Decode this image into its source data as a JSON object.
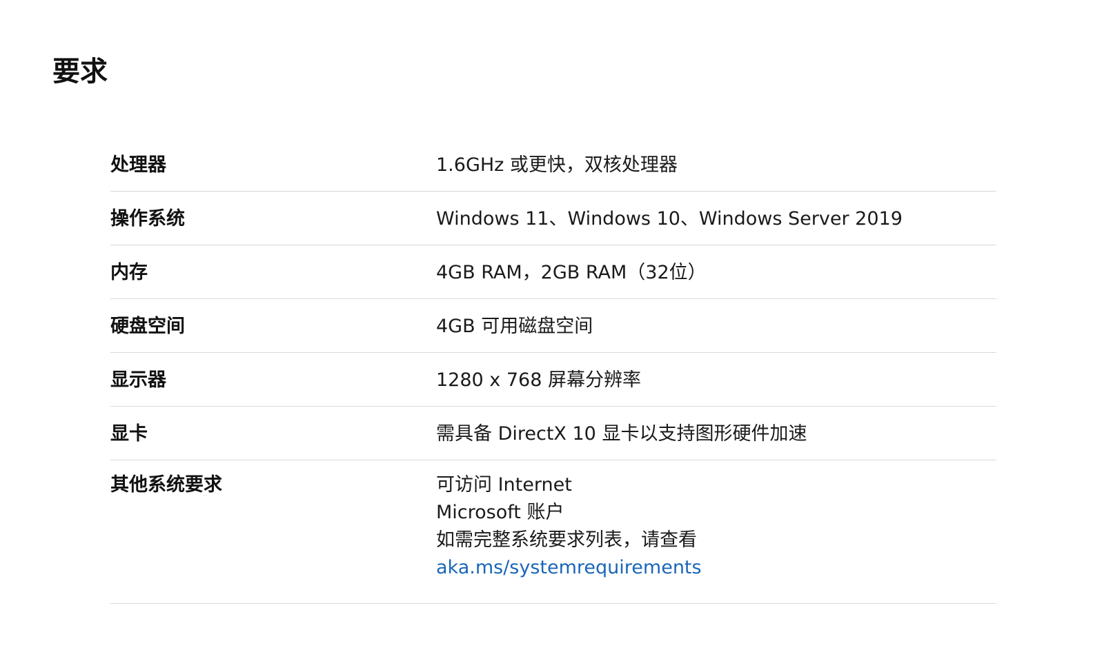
{
  "page": {
    "title": "要求"
  },
  "requirements": [
    {
      "label": "处理器",
      "value": "1.6GHz 或更快，双核处理器"
    },
    {
      "label": "操作系统",
      "value": "Windows 11、Windows 10、Windows Server 2019"
    },
    {
      "label": "内存",
      "value": "4GB RAM，2GB RAM（32位）"
    },
    {
      "label": "硬盘空间",
      "value": "4GB 可用磁盘空间"
    },
    {
      "label": "显示器",
      "value": "1280 x 768 屏幕分辨率"
    },
    {
      "label": "显卡",
      "value": "需具备 DirectX 10 显卡以支持图形硬件加速"
    }
  ],
  "other": {
    "label": "其他系统要求",
    "lines": [
      "可访问 Internet",
      "Microsoft 账户",
      "如需完整系统要求列表，请查看"
    ],
    "link_text": "aka.ms/systemrequirements"
  },
  "colors": {
    "link": "#1a66b8",
    "divider": "#d9d9d9",
    "text": "#1a1a1a"
  }
}
